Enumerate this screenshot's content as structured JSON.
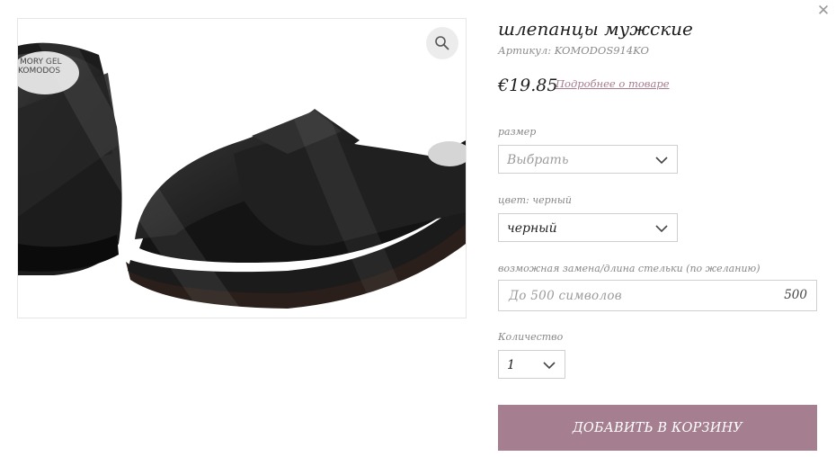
{
  "modal": {
    "close_icon": "close-icon"
  },
  "product": {
    "title": "шлепанцы мужские",
    "article": "Артикул: KOMODOS914KO",
    "price": "€19.85",
    "details_link": "Подробнее о товаре",
    "image_alt_icon": "sandal-product-photo",
    "image_logo_text": "KOMODOS"
  },
  "zoom": {
    "icon": "magnifier-icon"
  },
  "options": {
    "size": {
      "label": "размер",
      "value": "Выбрать"
    },
    "color": {
      "label": "цвет: черный",
      "value": "черный"
    },
    "insole": {
      "label": "возможная замена/длина стельки (по желанию)",
      "placeholder": "До 500 символов",
      "counter": "500"
    },
    "quantity": {
      "label": "Количество",
      "value": "1"
    }
  },
  "actions": {
    "add_to_cart": "ДОБАВИТЬ В КОРЗИНУ"
  },
  "colors": {
    "accent": "#a57e8f",
    "link": "#a87a8d",
    "border": "#cfcfcf"
  }
}
